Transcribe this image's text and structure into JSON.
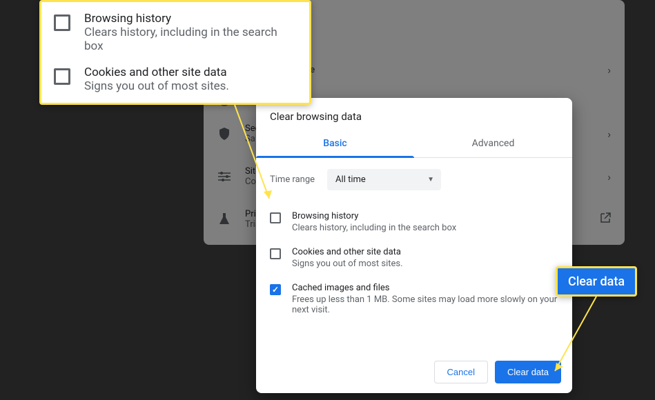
{
  "bg": {
    "row1_text": ", cache, and more",
    "security_title": "Secu",
    "security_sub": "Sa",
    "site_title": "Site",
    "site_sub": "Cont",
    "privacy_title": "Priva",
    "privacy_sub": "Trial"
  },
  "dialog": {
    "title": "Clear browsing data",
    "tabs": {
      "basic": "Basic",
      "advanced": "Advanced"
    },
    "time_label": "Time range",
    "time_value": "All time",
    "items": [
      {
        "checked": false,
        "title": "Browsing history",
        "desc": "Clears history, including in the search box"
      },
      {
        "checked": false,
        "title": "Cookies and other site data",
        "desc": "Signs you out of most sites."
      },
      {
        "checked": true,
        "title": "Cached images and files",
        "desc": "Frees up less than 1 MB. Some sites may load more slowly on your next visit."
      }
    ],
    "cancel": "Cancel",
    "clear": "Clear data"
  },
  "callout1": {
    "items": [
      {
        "title": "Browsing history",
        "desc": "Clears history, including in the search box"
      },
      {
        "title": "Cookies and other site data",
        "desc": "Signs you out of most sites."
      }
    ]
  },
  "callout2": {
    "label": "Clear data"
  }
}
